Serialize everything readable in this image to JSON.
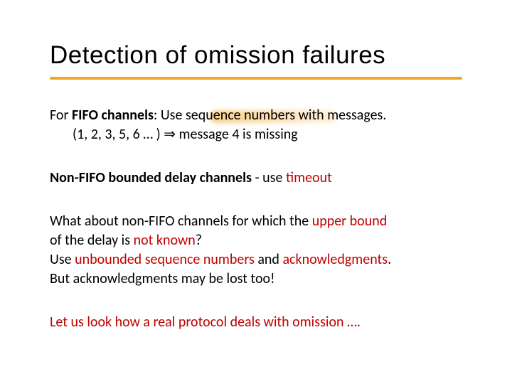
{
  "title": "Detection of omission failures",
  "p1": {
    "pre": "For ",
    "fifo": "FIFO channels",
    "mid": ": Use ",
    "seq": "sequence numbers",
    "post": " with messages.",
    "example": "(1, 2, 3, 5, 6 … ) ⇒ message 4 is missing"
  },
  "p2": {
    "pre": "Non-FIFO bounded delay channels",
    "mid": " - use ",
    "timeout": "timeout"
  },
  "p3": {
    "a": "What about non-FIFO channels for which the ",
    "ub": "upper bound",
    "b": " of the delay is ",
    "nk": "not known",
    "b2": "?",
    "c": "Use ",
    "usn": "unbounded sequence numbers",
    "d": " and ",
    "ack": "acknowledgments",
    "d2": ".",
    "e": "But acknowledgments may be lost too!"
  },
  "p4": "Let us look how a real protocol deals with omission …."
}
